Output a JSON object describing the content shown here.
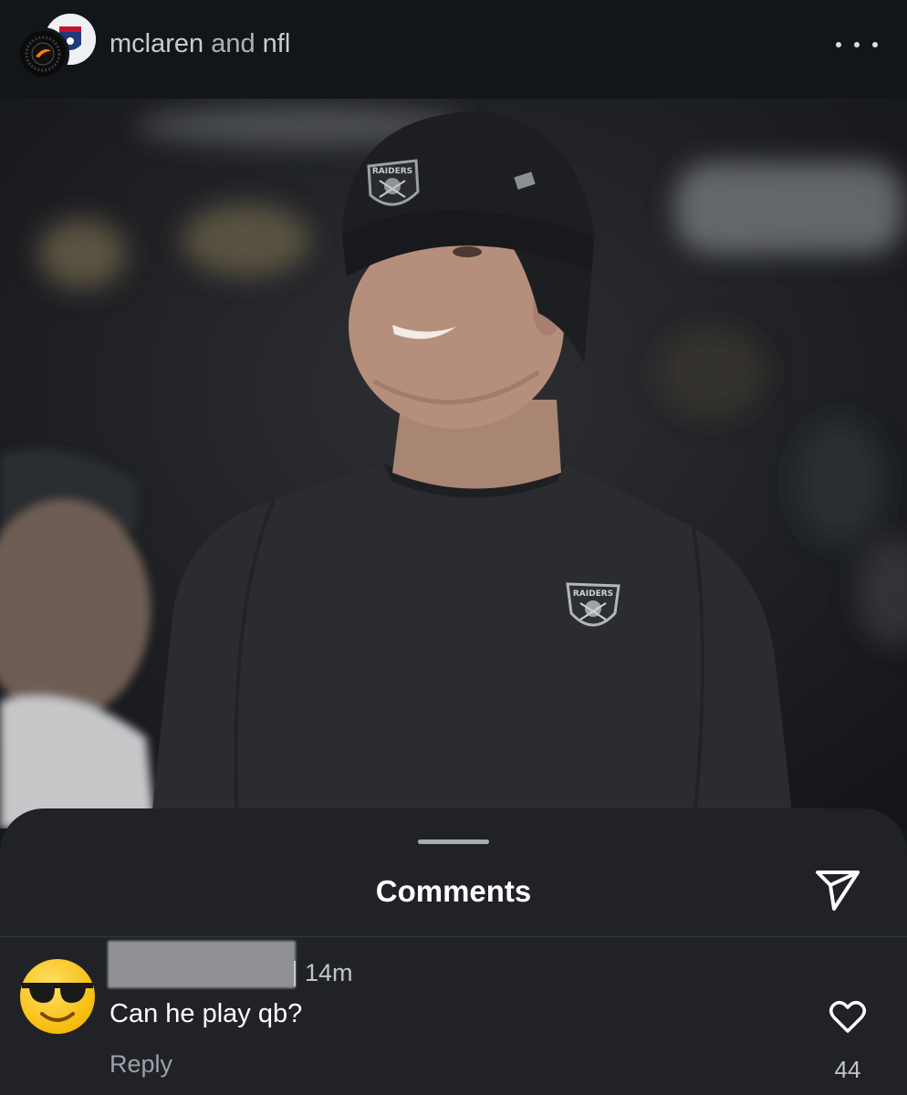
{
  "header": {
    "user_one": "mclaren",
    "connector": "and",
    "user_two": "nfl"
  },
  "photo": {
    "cap_logo_text": "RAIDERS",
    "shirt_logo_text": "RAIDERS"
  },
  "comments_sheet": {
    "title": "Comments",
    "comments": [
      {
        "time": "14m",
        "text": "Can he play qb?",
        "reply_label": "Reply",
        "likes": "44",
        "avatar_icon": "sunglasses-emoji-icon"
      }
    ]
  },
  "icons": {
    "more": "more-options-icon",
    "share": "send-icon",
    "like": "heart-outline-icon"
  },
  "colors": {
    "header_bg": "#12151a",
    "sheet_bg": "#202227",
    "text_primary": "#ffffff",
    "text_secondary": "#9ea2a8"
  }
}
